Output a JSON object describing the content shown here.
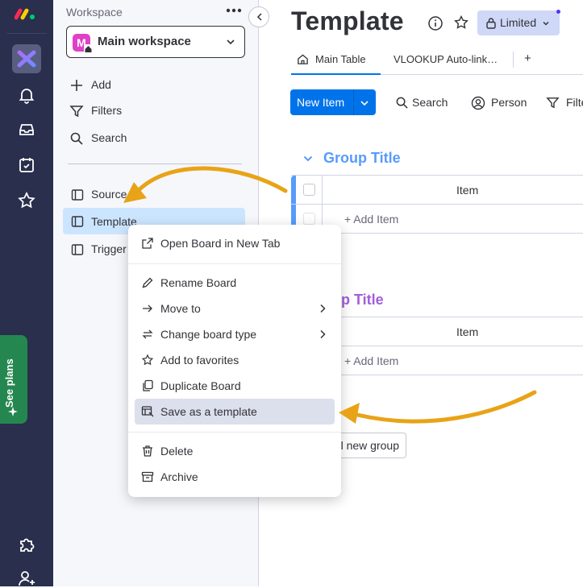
{
  "rail": {
    "items": [
      "monday-logo",
      "workspaces-icon",
      "bell-icon",
      "inbox-icon",
      "calendar-check-icon",
      "star-icon",
      "puzzle-icon",
      "invite-user-icon"
    ],
    "see_plans_label": "See plans"
  },
  "sidebar": {
    "workspace_label": "Workspace",
    "workspace_name": "Main workspace",
    "workspace_initial": "M",
    "actions": {
      "add": "Add",
      "filters": "Filters",
      "search": "Search"
    },
    "boards": [
      "Source",
      "Template",
      "Trigger"
    ]
  },
  "header": {
    "title": "Template",
    "limited_label": "Limited",
    "tabs": [
      "Main Table",
      "VLOOKUP Auto-link…"
    ],
    "add_tab": "+"
  },
  "toolbar": {
    "new_item": "New Item",
    "search": "Search",
    "person": "Person",
    "filter": "Filte"
  },
  "groups": [
    {
      "title": "Group Title",
      "color": "#579bfc",
      "column": "Item",
      "add_item": "+ Add Item"
    },
    {
      "title": "oup Title",
      "color": "#a25ddc",
      "column": "Item",
      "add_item": "+ Add Item"
    }
  ],
  "add_group_label": "l new group",
  "context_menu": {
    "items": [
      {
        "label": "Open Board in New Tab",
        "icon": "external-link-icon"
      },
      {
        "label": "Rename Board",
        "icon": "pencil-icon"
      },
      {
        "label": "Move to",
        "icon": "arrow-right-icon",
        "submenu": true
      },
      {
        "label": "Change board type",
        "icon": "swap-icon",
        "submenu": true
      },
      {
        "label": "Add to favorites",
        "icon": "star-icon"
      },
      {
        "label": "Duplicate Board",
        "icon": "duplicate-icon"
      },
      {
        "label": "Save as a template",
        "icon": "template-icon",
        "highlighted": true
      },
      {
        "label": "Delete",
        "icon": "trash-icon"
      },
      {
        "label": "Archive",
        "icon": "archive-icon"
      }
    ]
  },
  "colors": {
    "rail": "#292f4c",
    "primary": "#0073ea",
    "annotation_arrow": "#e8a317",
    "see_plans": "#258750",
    "active_board": "#cce5ff"
  }
}
